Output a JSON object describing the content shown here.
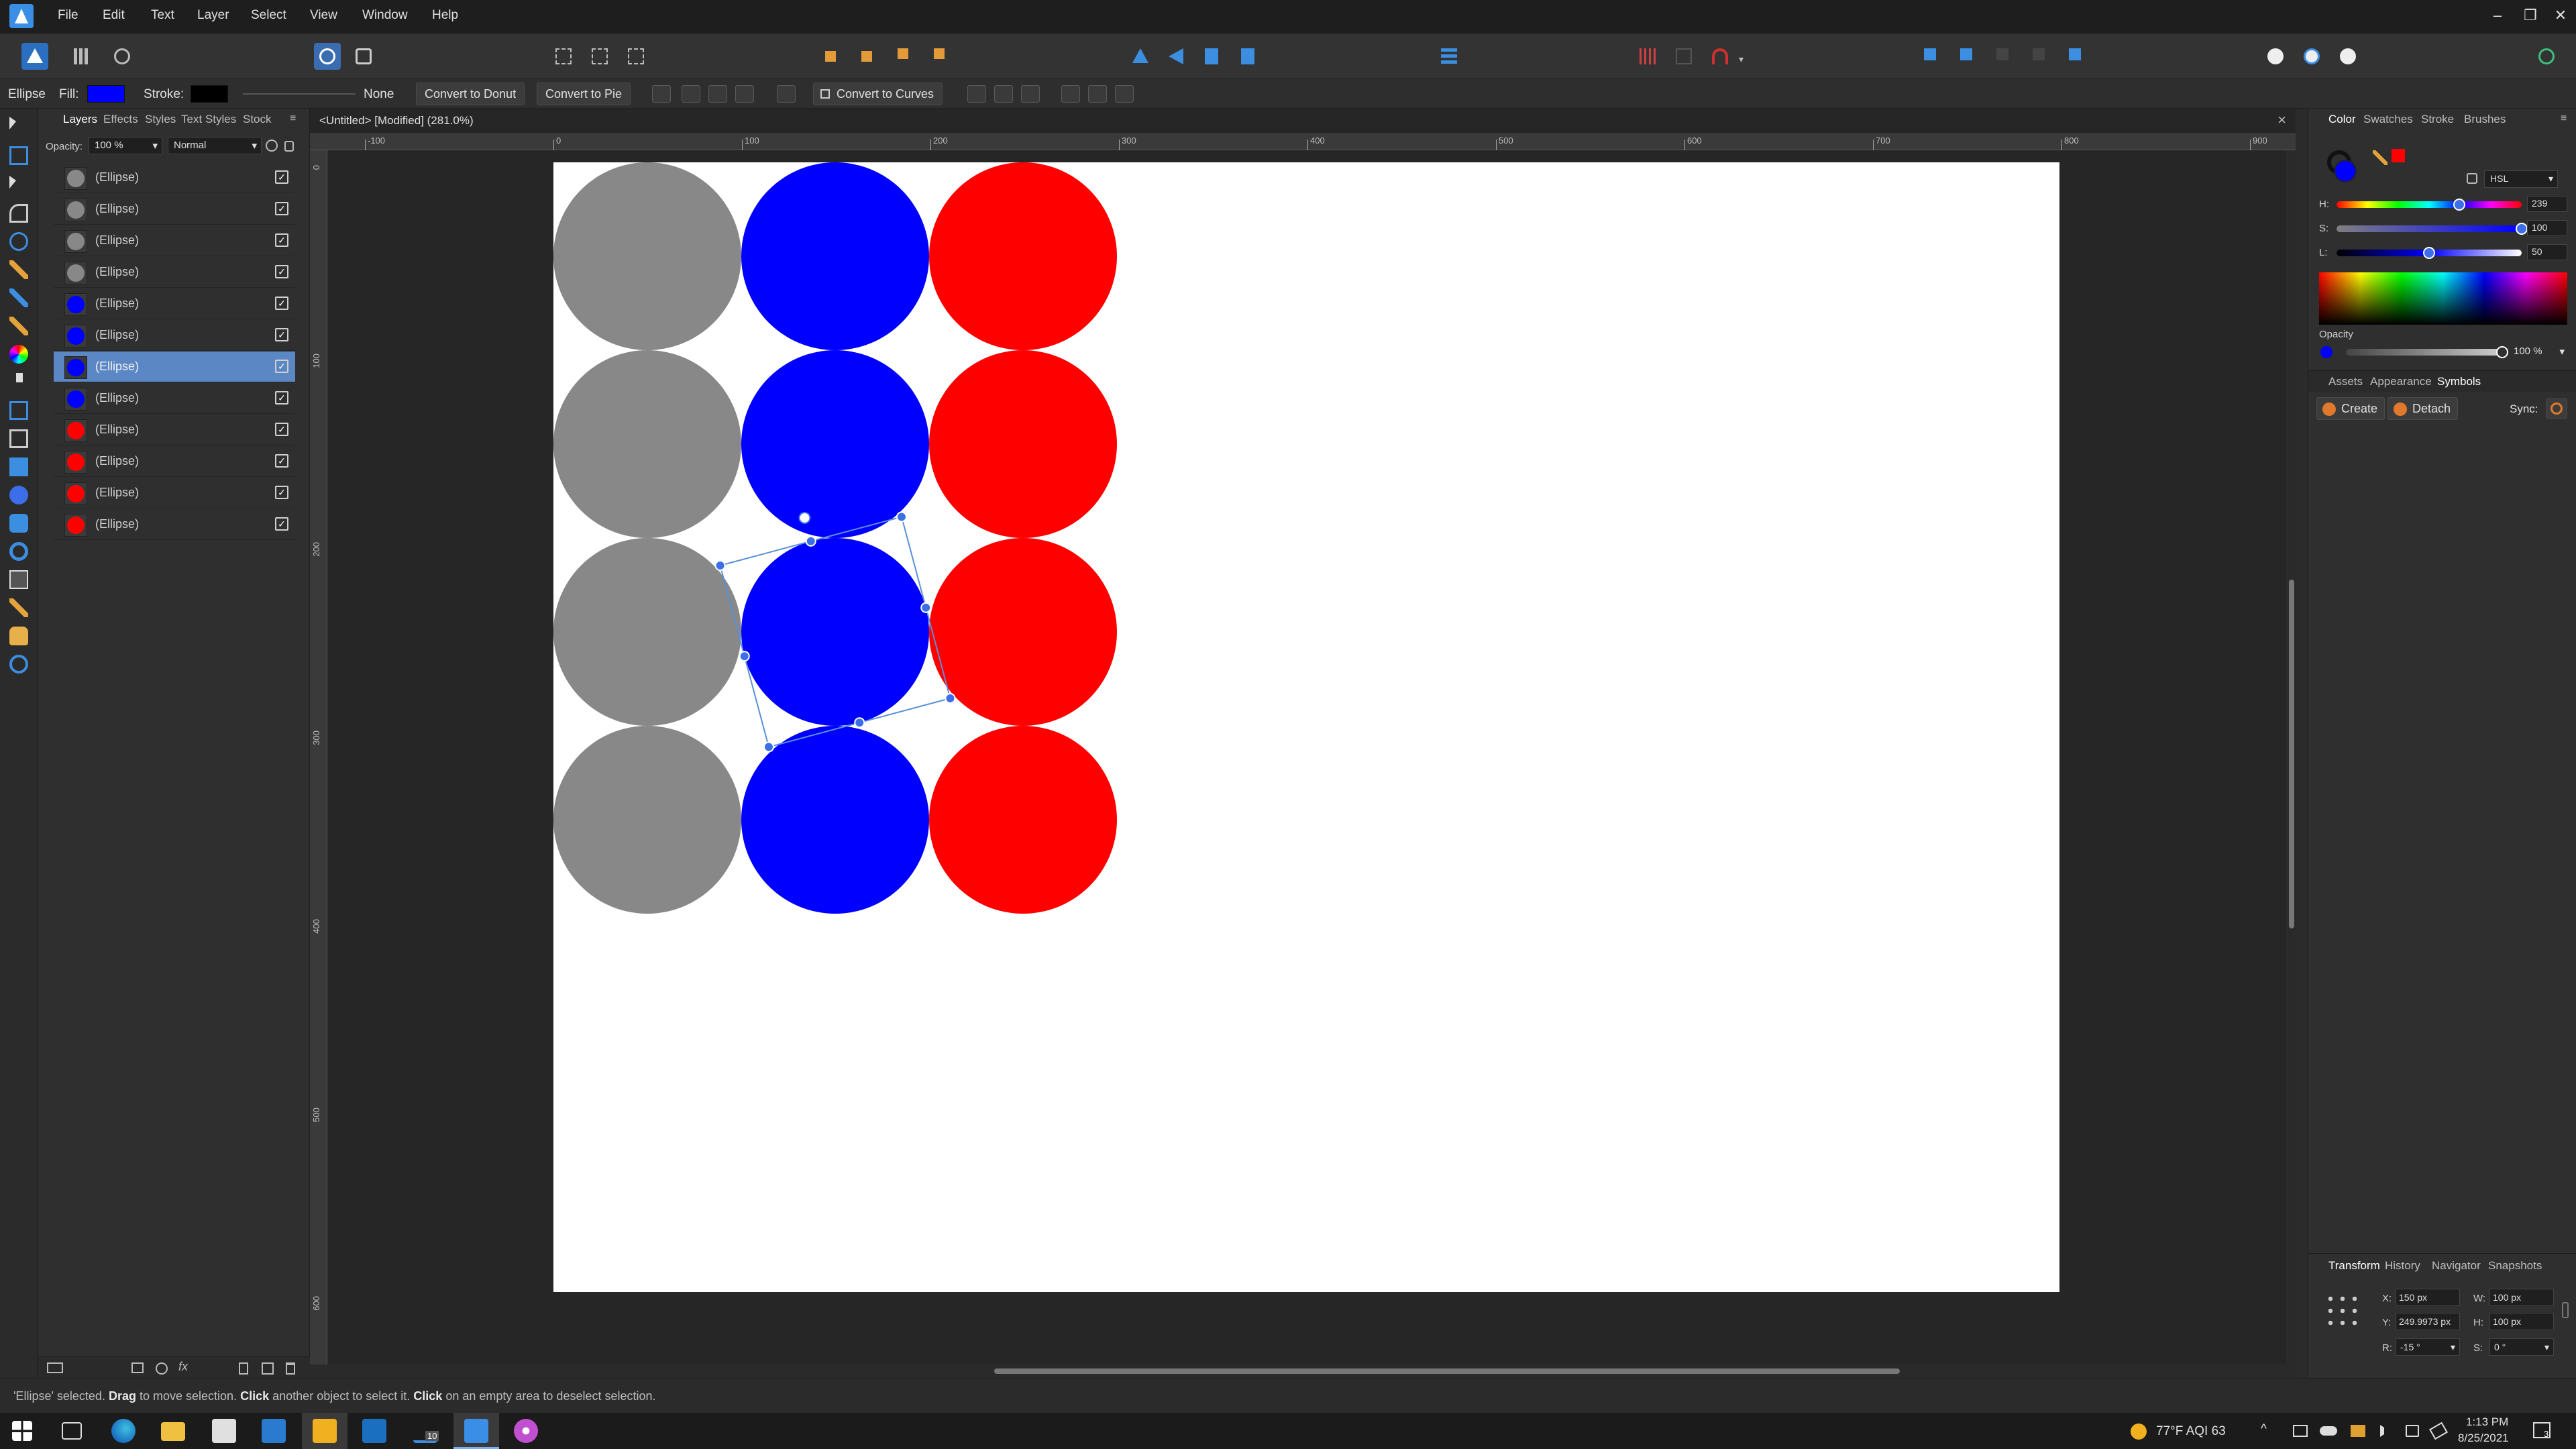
{
  "menubar": {
    "items": [
      "File",
      "Edit",
      "Text",
      "Layer",
      "Select",
      "View",
      "Window",
      "Help"
    ]
  },
  "context": {
    "tool_name": "Ellipse",
    "fill_label": "Fill:",
    "stroke_label": "Stroke:",
    "stroke_style": "None",
    "fill_color": "#0000ff",
    "stroke_color": "#000000",
    "buttons": [
      "Convert to Donut",
      "Convert to Pie",
      "Convert to Curves"
    ]
  },
  "layers_panel": {
    "tabs": [
      "Layers",
      "Effects",
      "Styles",
      "Text Styles",
      "Stock"
    ],
    "opacity_label": "Opacity:",
    "opacity_value": "100 %",
    "blend_mode": "Normal",
    "rows": [
      {
        "name": "(Ellipse)",
        "color": "#888888",
        "selected": false
      },
      {
        "name": "(Ellipse)",
        "color": "#888888",
        "selected": false
      },
      {
        "name": "(Ellipse)",
        "color": "#888888",
        "selected": false
      },
      {
        "name": "(Ellipse)",
        "color": "#888888",
        "selected": false
      },
      {
        "name": "(Ellipse)",
        "color": "#0000ff",
        "selected": false
      },
      {
        "name": "(Ellipse)",
        "color": "#0000ff",
        "selected": false
      },
      {
        "name": "(Ellipse)",
        "color": "#0000ff",
        "selected": true
      },
      {
        "name": "(Ellipse)",
        "color": "#0000ff",
        "selected": false
      },
      {
        "name": "(Ellipse)",
        "color": "#ff0000",
        "selected": false
      },
      {
        "name": "(Ellipse)",
        "color": "#ff0000",
        "selected": false
      },
      {
        "name": "(Ellipse)",
        "color": "#ff0000",
        "selected": false
      },
      {
        "name": "(Ellipse)",
        "color": "#ff0000",
        "selected": false
      }
    ]
  },
  "document": {
    "tab_title": "<Untitled> [Modified] (281.0%)",
    "close_glyph": "×",
    "ruler_top_labels": [
      "-100",
      "0",
      "100",
      "200",
      "300",
      "400",
      "500",
      "600",
      "700",
      "800",
      "900"
    ],
    "ruler_left_labels": [
      "0",
      "100",
      "200",
      "300",
      "400",
      "500",
      "600"
    ]
  },
  "color_panel": {
    "tabs": [
      "Color",
      "Swatches",
      "Stroke",
      "Brushes"
    ],
    "model": "HSL",
    "h_label": "H:",
    "s_label": "S:",
    "l_label": "L:",
    "h_value": "239",
    "s_value": "100",
    "l_value": "50",
    "hue_fraction": 0.664,
    "sat_fraction": 1.0,
    "light_fraction": 0.5,
    "opacity_label": "Opacity",
    "opacity_value": "100 %"
  },
  "symbols_panel": {
    "tabs": [
      "Assets",
      "Appearance",
      "Symbols"
    ],
    "create_label": "Create",
    "detach_label": "Detach",
    "sync_label": "Sync:"
  },
  "transform_panel": {
    "tabs": [
      "Transform",
      "History",
      "Navigator",
      "Snapshots"
    ],
    "x_label": "X:",
    "x_value": "150 px",
    "y_label": "Y:",
    "y_value": "249.9973 px",
    "w_label": "W:",
    "w_value": "100 px",
    "h_label": "H:",
    "h_value": "100 px",
    "r_label": "R:",
    "r_value": "-15 °",
    "s_label": "S:",
    "s_value": "0 °"
  },
  "status": {
    "prefix": "'Ellipse' selected.",
    "drag": "Drag",
    "drag_rest": "to move selection.",
    "click1": "Click",
    "click1_rest": "another object to select it.",
    "click2": "Click",
    "click2_rest": "on an empty area to deselect selection."
  },
  "taskbar": {
    "weather": "77°F  AQI 63",
    "time": "1:13 PM",
    "date": "8/25/2021",
    "badge_count": "10",
    "notif_count": "3"
  }
}
